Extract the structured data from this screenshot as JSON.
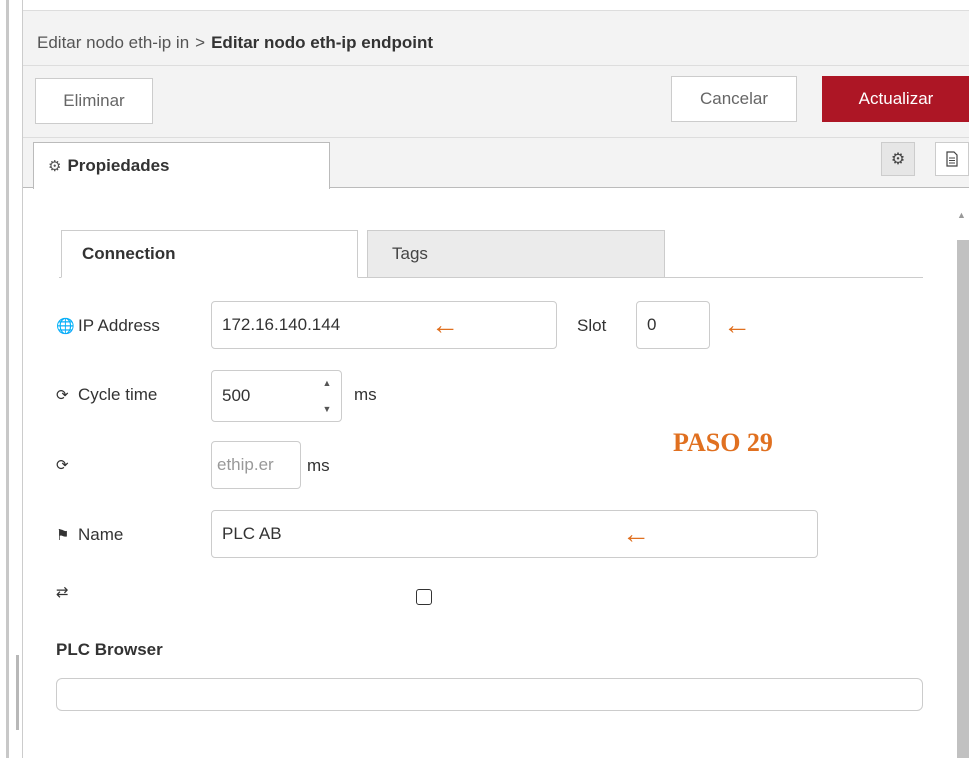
{
  "breadcrumb": {
    "parent": "Editar nodo eth-ip in",
    "separator": ">",
    "current": "Editar nodo eth-ip endpoint"
  },
  "toolbar": {
    "delete_label": "Eliminar",
    "cancel_label": "Cancelar",
    "update_label": "Actualizar"
  },
  "tabs": {
    "properties_label": "Propiedades",
    "settings_icon": "gear-icon",
    "info_icon": "document-icon"
  },
  "form_tabs": [
    "Connection",
    "Tags"
  ],
  "form": {
    "ip_label": "IP Address",
    "ip_value": "172.16.140.144",
    "slot_label": "Slot",
    "slot_value": "0",
    "cycle_label": "Cycle time",
    "cycle_value": "500",
    "cycle_unit": "ms",
    "refresh_placeholder": "ethip.er",
    "refresh_unit": "ms",
    "name_label": "Name",
    "name_value": "PLC AB",
    "plc_browser_label": "PLC Browser"
  },
  "annotation": {
    "text": "PASO 29",
    "arrow": "←",
    "color": "#e07020"
  },
  "colors": {
    "accent": "#ad1625",
    "header_bg": "#f3f3f3",
    "annotation": "#e07020"
  }
}
